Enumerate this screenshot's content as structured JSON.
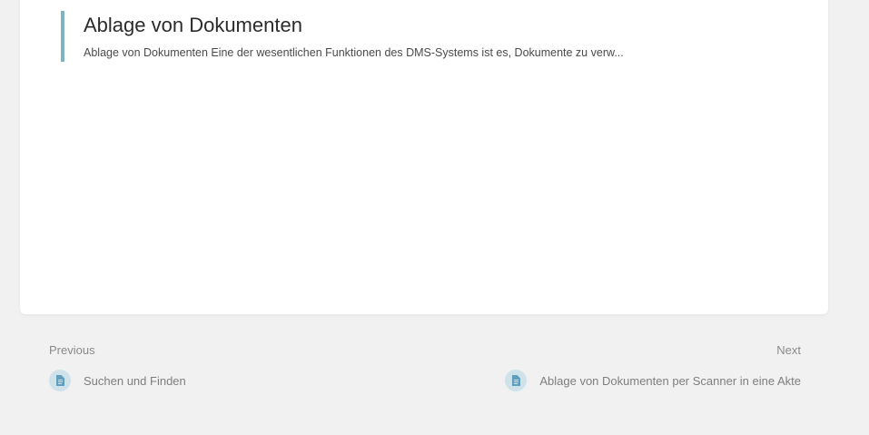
{
  "entry": {
    "title": "Ablage von Dokumenten",
    "excerpt": "Ablage von Dokumenten Eine der wesentlichen Funktionen des DMS-Systems ist es, Dokumente zu verw..."
  },
  "navigation": {
    "previous": {
      "heading": "Previous",
      "link_label": "Suchen und Finden",
      "icon": "document-icon"
    },
    "next": {
      "heading": "Next",
      "link_label": "Ablage von Dokumenten per Scanner in eine Akte",
      "icon": "document-icon"
    }
  },
  "colors": {
    "page_background": "#f1f1f1",
    "card_background": "#ffffff",
    "accent_border": "#7fb3c3",
    "icon_background": "#cfe2ea",
    "icon_foreground": "#5f9fbc"
  }
}
